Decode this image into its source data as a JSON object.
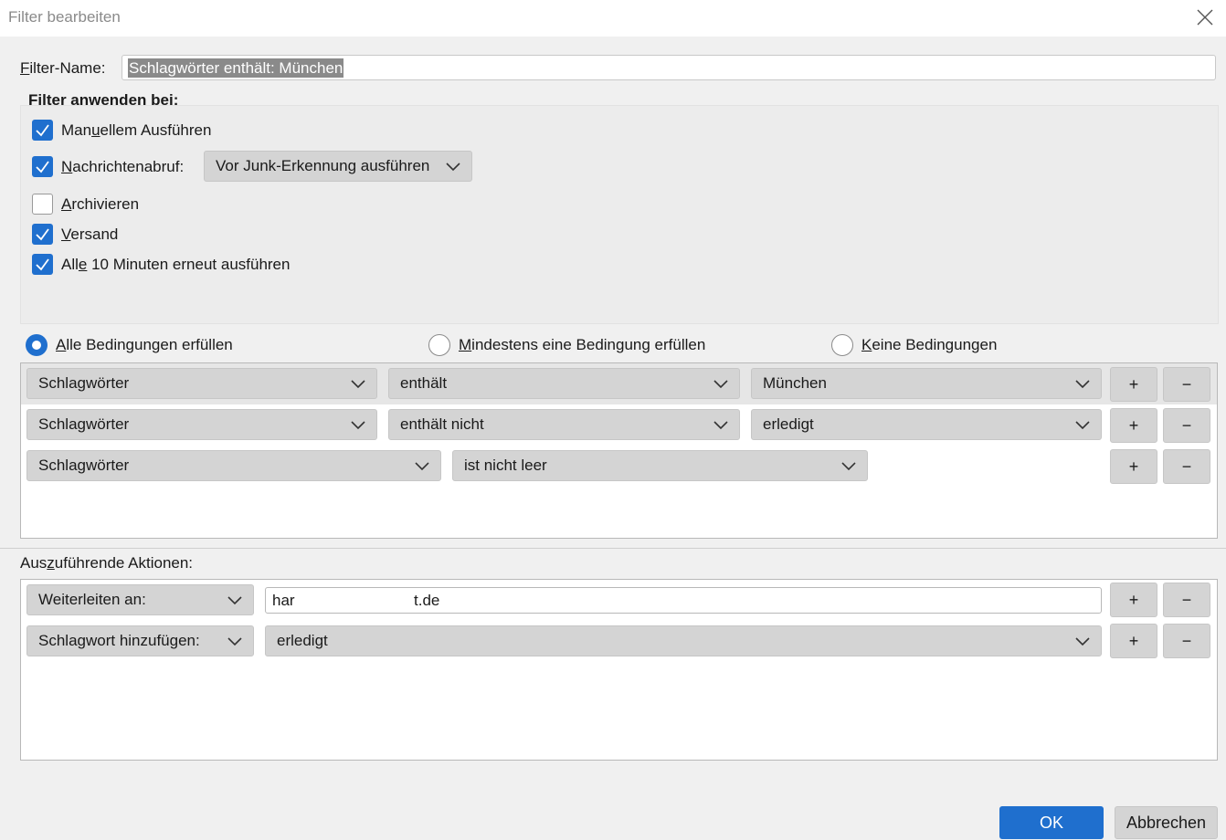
{
  "window": {
    "title": "Filter bearbeiten"
  },
  "filter_name": {
    "label_pre": "",
    "label_key": "F",
    "label_post": "ilter-Name:",
    "value": "Schlagwörter enthält: München"
  },
  "apply": {
    "heading": "Filter anwenden bei:",
    "manual": {
      "pre": "Man",
      "key": "u",
      "post": "ellem Ausführen",
      "checked": true
    },
    "fetch": {
      "pre": "",
      "key": "N",
      "post": "achrichtenabruf:",
      "checked": true,
      "timing": "Vor Junk-Erkennung ausführen"
    },
    "archive": {
      "pre": "",
      "key": "A",
      "post": "rchivieren",
      "checked": false
    },
    "send": {
      "pre": "",
      "key": "V",
      "post": "ersand",
      "checked": true
    },
    "periodic": {
      "pre": "All",
      "key": "e",
      "post": " 10 Minuten erneut ausführen",
      "checked": true
    }
  },
  "match": {
    "all": {
      "pre": "",
      "key": "A",
      "post": "lle Bedingungen erfüllen",
      "selected": true
    },
    "any": {
      "pre": "",
      "key": "M",
      "post": "indestens eine Bedingung erfüllen",
      "selected": false
    },
    "none": {
      "pre": "",
      "key": "K",
      "post": "eine Bedingungen",
      "selected": false
    }
  },
  "conditions": [
    {
      "attribute": "Schlagwörter",
      "operator": "enthält",
      "value": "München"
    },
    {
      "attribute": "Schlagwörter",
      "operator": "enthält nicht",
      "value": "erledigt"
    },
    {
      "attribute": "Schlagwörter",
      "operator": "ist nicht leer",
      "value": ""
    }
  ],
  "actions": {
    "heading": {
      "pre": "Aus",
      "key": "z",
      "post": "uführende Aktionen:"
    },
    "rows": [
      {
        "action": "Weiterleiten an:",
        "value_a": "har",
        "value_b": "t.de"
      },
      {
        "action": "Schlagwort hinzufügen:",
        "value": "erledigt"
      }
    ]
  },
  "buttons": {
    "add": "+",
    "remove": "−",
    "ok": "OK",
    "cancel": "Abbrechen"
  },
  "icons": {
    "check": "check-icon",
    "chevron": "chevron-down-icon",
    "close": "close-icon"
  },
  "colors": {
    "accent": "#1f6fce",
    "dropdown": "#d4d4d4",
    "background": "#f0f0f0"
  }
}
